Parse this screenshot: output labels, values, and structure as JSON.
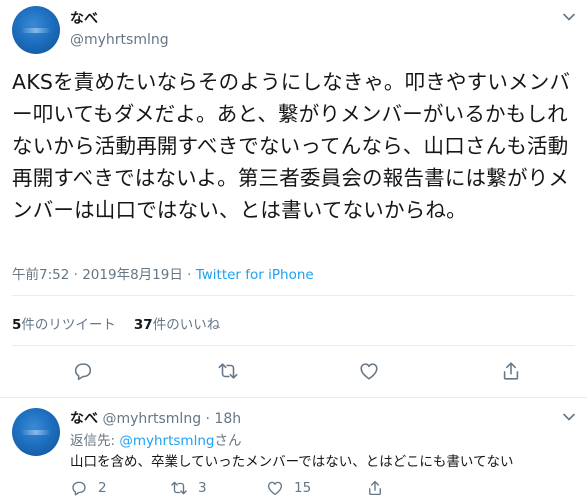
{
  "tweet": {
    "author_name": "なべ",
    "author_handle": "@myhrtsmlng",
    "text": "AKSを責めたいならそのようにしなきゃ。叩きやすいメンバー叩いてもダメだよ。あと、繋がりメンバーがいるかもしれないから活動再開すべきでないってんなら、山口さんも活動再開すべきではないよ。第三者委員会の報告書には繋がりメンバーは山口ではない、とは書いてないからね。",
    "time": "午前7:52",
    "separator": "·",
    "date": "2019年8月19日",
    "source": "Twitter for iPhone",
    "retweets_count": "5",
    "retweets_label": "件のリツイート",
    "likes_count": "37",
    "likes_label": "件のいいね"
  },
  "reply": {
    "author_name": "なべ",
    "author_handle": "@myhrtsmlng",
    "time_ago": "· 18h",
    "reply_to_prefix": "返信先: ",
    "reply_to_handle": "@myhrtsmlng",
    "reply_to_suffix": "さん",
    "text": "山口を含め、卒業していったメンバーではない、とはどこにも書いてない",
    "reply_count": "2",
    "retweet_count": "3",
    "like_count": "15"
  },
  "icons": {
    "more": "chevron-down-icon",
    "reply": "comment-icon",
    "retweet": "retweet-icon",
    "like": "heart-icon",
    "share": "share-icon"
  },
  "colors": {
    "link": "#1da1f2",
    "muted": "#657786",
    "text": "#14171a",
    "divider": "#e6ecf0"
  }
}
